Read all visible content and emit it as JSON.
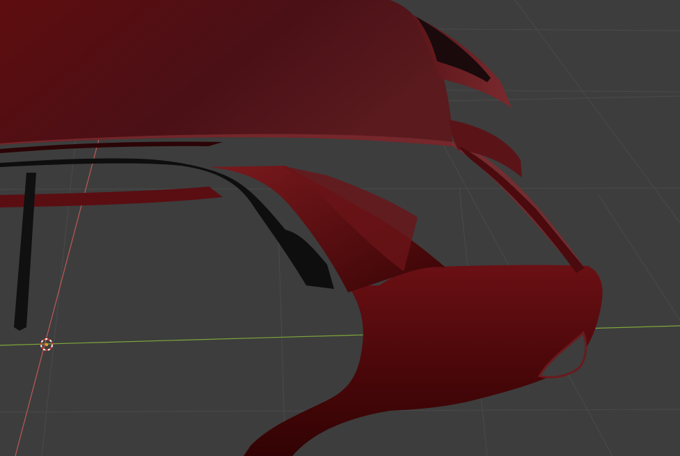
{
  "viewport": {
    "mode": "3d-viewport",
    "background_color": "#3d3d3d",
    "grid_line_color": "#4a4a4a",
    "x_axis_color": "#c05858",
    "y_axis_color": "#7fa83a",
    "model_color": "#5a0d0d"
  },
  "model": {
    "name": "car-rear-body-shell",
    "visible_parts": [
      "roof",
      "rear-spoiler",
      "c-pillar",
      "rear-quarter-panel",
      "window-trim",
      "rear-light-cutout"
    ]
  },
  "cursor": {
    "name": "3d-cursor"
  }
}
